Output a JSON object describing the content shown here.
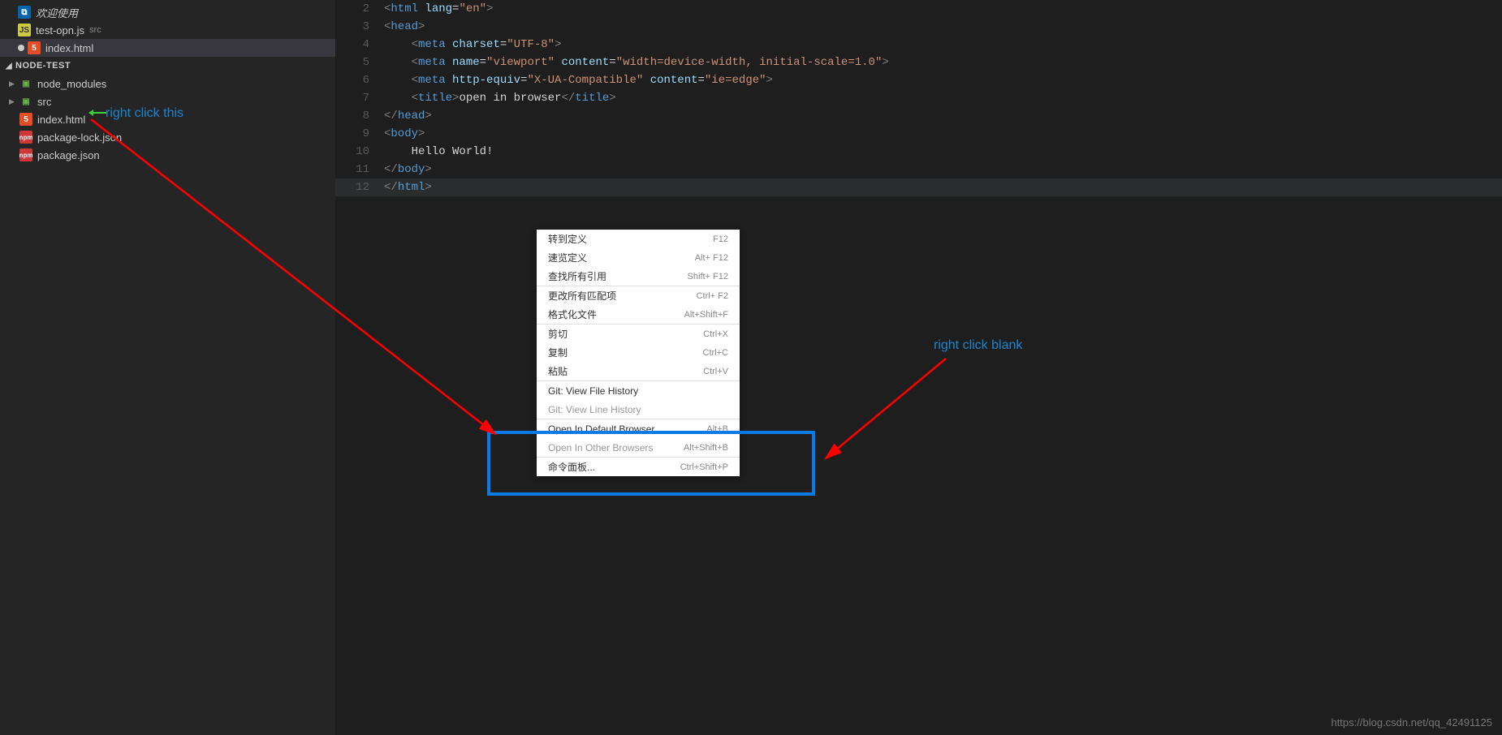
{
  "sidebar": {
    "openEditors": [
      {
        "icon": "vscode",
        "label": "欢迎使用",
        "italic": true
      },
      {
        "icon": "js",
        "label": "test-opn.js",
        "sub": "src"
      },
      {
        "icon": "html",
        "label": "index.html",
        "unsaved": true
      }
    ],
    "sectionHeader": "NODE-TEST",
    "tree": [
      {
        "type": "folder",
        "icon": "folder",
        "label": "node_modules",
        "collapsed": true
      },
      {
        "type": "folder",
        "icon": "folder",
        "label": "src",
        "collapsed": true
      },
      {
        "type": "file",
        "icon": "html",
        "label": "index.html"
      },
      {
        "type": "file",
        "icon": "npm",
        "label": "package-lock.json"
      },
      {
        "type": "file",
        "icon": "npm",
        "label": "package.json"
      }
    ]
  },
  "annotations": {
    "left": "right click this",
    "right": "right click blank"
  },
  "code": {
    "startLine": 2,
    "lines": [
      {
        "raw": "<html lang=\"en\">",
        "parts": [
          [
            "<",
            "tb"
          ],
          [
            "html",
            "tn"
          ],
          [
            " ",
            ""
          ],
          [
            "lang",
            "an"
          ],
          [
            "=",
            ""
          ],
          [
            "\"en\"",
            "av"
          ],
          [
            ">",
            "tb"
          ]
        ]
      },
      {
        "raw": "<head>",
        "parts": [
          [
            "<",
            "tb"
          ],
          [
            "head",
            "tn"
          ],
          [
            ">",
            "tb"
          ]
        ]
      },
      {
        "raw": "    <meta charset=\"UTF-8\">",
        "parts": [
          [
            "    ",
            ""
          ],
          [
            "<",
            "tb"
          ],
          [
            "meta",
            "tn"
          ],
          [
            " ",
            ""
          ],
          [
            "charset",
            "an"
          ],
          [
            "=",
            ""
          ],
          [
            "\"UTF-8\"",
            "av"
          ],
          [
            ">",
            "tb"
          ]
        ]
      },
      {
        "raw": "    <meta name=\"viewport\" content=\"width=device-width, initial-scale=1.0\">",
        "parts": [
          [
            "    ",
            ""
          ],
          [
            "<",
            "tb"
          ],
          [
            "meta",
            "tn"
          ],
          [
            " ",
            ""
          ],
          [
            "name",
            "an"
          ],
          [
            "=",
            ""
          ],
          [
            "\"viewport\"",
            "av"
          ],
          [
            " ",
            ""
          ],
          [
            "content",
            "an"
          ],
          [
            "=",
            ""
          ],
          [
            "\"width=device-width, initial-scale=1.0\"",
            "av"
          ],
          [
            ">",
            "tb"
          ]
        ]
      },
      {
        "raw": "    <meta http-equiv=\"X-UA-Compatible\" content=\"ie=edge\">",
        "parts": [
          [
            "    ",
            ""
          ],
          [
            "<",
            "tb"
          ],
          [
            "meta",
            "tn"
          ],
          [
            " ",
            ""
          ],
          [
            "http-equiv",
            "an"
          ],
          [
            "=",
            ""
          ],
          [
            "\"X-UA-Compatible\"",
            "av"
          ],
          [
            " ",
            ""
          ],
          [
            "content",
            "an"
          ],
          [
            "=",
            ""
          ],
          [
            "\"ie=edge\"",
            "av"
          ],
          [
            ">",
            "tb"
          ]
        ]
      },
      {
        "raw": "    <title>open in browser</title>",
        "parts": [
          [
            "    ",
            ""
          ],
          [
            "<",
            "tb"
          ],
          [
            "title",
            "tn"
          ],
          [
            ">",
            "tb"
          ],
          [
            "open in browser",
            "tx"
          ],
          [
            "</",
            "tb"
          ],
          [
            "title",
            "tn"
          ],
          [
            ">",
            "tb"
          ]
        ]
      },
      {
        "raw": "</head>",
        "parts": [
          [
            "</",
            "tb"
          ],
          [
            "head",
            "tn"
          ],
          [
            ">",
            "tb"
          ]
        ]
      },
      {
        "raw": "<body>",
        "parts": [
          [
            "<",
            "tb"
          ],
          [
            "body",
            "tn"
          ],
          [
            ">",
            "tb"
          ]
        ]
      },
      {
        "raw": "    Hello World!",
        "parts": [
          [
            "    Hello World!",
            "tx"
          ]
        ]
      },
      {
        "raw": "</body>",
        "parts": [
          [
            "</",
            "tb"
          ],
          [
            "body",
            "tn"
          ],
          [
            ">",
            "tb"
          ]
        ]
      },
      {
        "raw": "</html>",
        "parts": [
          [
            "</",
            "tb"
          ],
          [
            "html",
            "tn"
          ],
          [
            ">",
            "tb"
          ]
        ],
        "hl": true
      }
    ]
  },
  "contextMenu": {
    "groups": [
      [
        {
          "label": "转到定义",
          "shortcut": "F12"
        },
        {
          "label": "速览定义",
          "shortcut": "Alt+  F12"
        },
        {
          "label": "查找所有引用",
          "shortcut": "Shift+  F12"
        }
      ],
      [
        {
          "label": "更改所有匹配项",
          "shortcut": "Ctrl+  F2"
        },
        {
          "label": "格式化文件",
          "shortcut": "Alt+Shift+F"
        }
      ],
      [
        {
          "label": "剪切",
          "shortcut": "Ctrl+X"
        },
        {
          "label": "复制",
          "shortcut": "Ctrl+C"
        },
        {
          "label": "粘贴",
          "shortcut": "Ctrl+V"
        }
      ],
      [
        {
          "label": "Git: View File History",
          "shortcut": ""
        },
        {
          "label": "Git: View Line History",
          "shortcut": "",
          "disabled": true
        }
      ],
      [
        {
          "label": "Open In Default Browser",
          "shortcut": "Alt+B"
        },
        {
          "label": "Open In Other Browsers",
          "shortcut": "Alt+Shift+B",
          "disabled": true
        }
      ],
      [
        {
          "label": "命令面板...",
          "shortcut": "Ctrl+Shift+P"
        }
      ]
    ]
  },
  "watermark": "https://blog.csdn.net/qq_42491125"
}
